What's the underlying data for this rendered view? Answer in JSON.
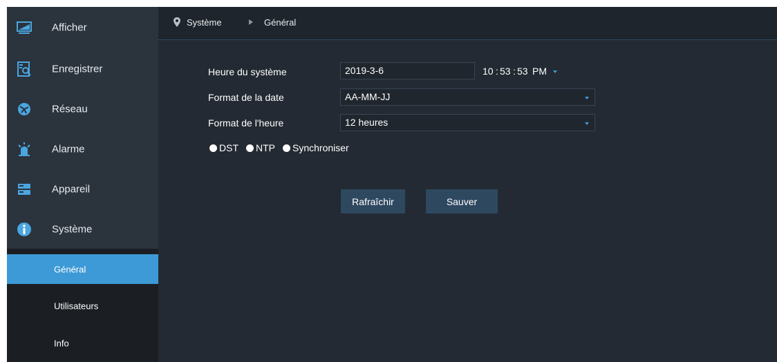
{
  "sidebar": {
    "items": [
      {
        "label": "Afficher"
      },
      {
        "label": "Enregistrer"
      },
      {
        "label": "Réseau"
      },
      {
        "label": "Alarme"
      },
      {
        "label": "Appareil"
      },
      {
        "label": "Système"
      }
    ],
    "sub_items": [
      {
        "label": "Général",
        "active": true
      },
      {
        "label": "Utilisateurs"
      },
      {
        "label": "Info"
      }
    ]
  },
  "breadcrumb": {
    "root": "Système",
    "current": "Général"
  },
  "form": {
    "system_time_label": "Heure du système",
    "system_date_value": "2019-3-6",
    "time_hours": "10",
    "time_minutes": "53",
    "time_seconds": "53",
    "time_ampm": "PM",
    "date_format_label": "Format de la date",
    "date_format_value": "AA-MM-JJ",
    "time_format_label": "Format de l'heure",
    "time_format_value": "12 heures",
    "options": {
      "dst": "DST",
      "ntp": "NTP",
      "sync": "Synchroniser"
    }
  },
  "actions": {
    "refresh_label": "Rafraîchir",
    "save_label": "Sauver"
  },
  "colors": {
    "accent": "#3d9ad6",
    "sidebar_bg": "#2b333d",
    "content_bg": "#232a33",
    "button_bg": "#2e4860"
  }
}
